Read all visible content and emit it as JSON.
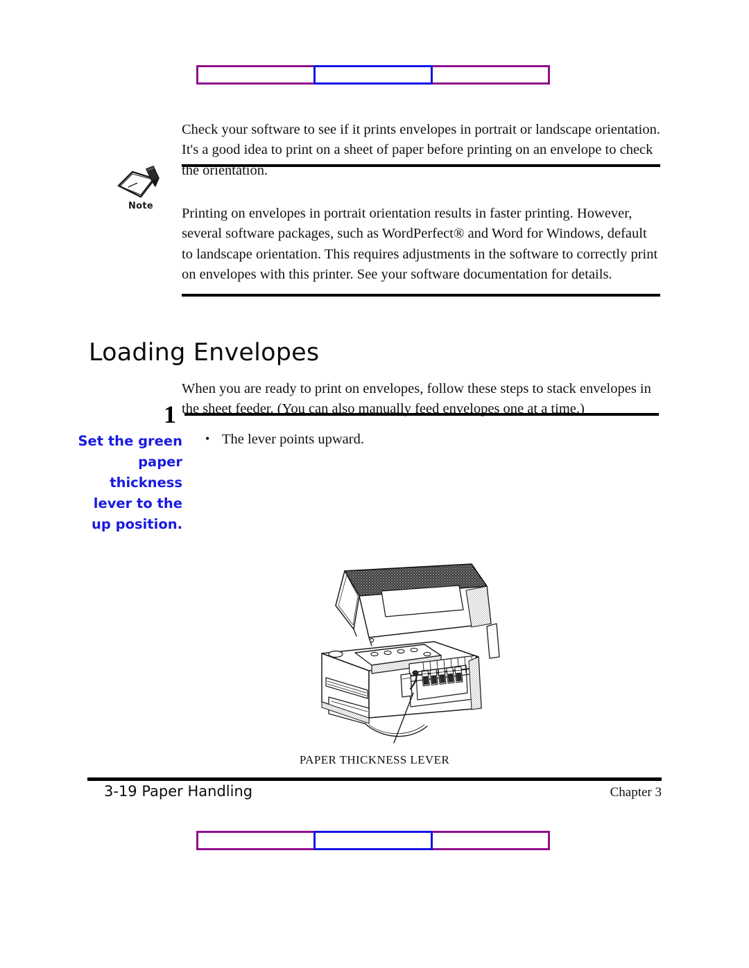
{
  "document": {
    "type": "printer-user-manual-page",
    "page_label": "3-19",
    "chapter_label": "Chapter 3"
  },
  "decoration": {
    "segments": [
      {
        "name": "left-segment",
        "color": "#8e0f8e"
      },
      {
        "name": "center-segment",
        "color": "#1414e6"
      },
      {
        "name": "right-segment",
        "color": "#8e0f8e"
      }
    ]
  },
  "intro": {
    "paragraph": "Check your software to see if it prints envelopes in portrait or landscape orientation. It's a good idea to print on a sheet of paper before printing on an envelope to check the orientation."
  },
  "note": {
    "icon_label": "Note",
    "icon_name": "note-pencil-icon",
    "paragraph": "Printing on envelopes in portrait orientation results in faster printing. However, several software packages, such as WordPerfect® and Word for Windows, default to landscape orientation. This requires adjustments in the software to correctly print on envelopes with this printer. See your software documentation for details."
  },
  "section": {
    "heading": "Loading Envelopes",
    "intro": "When you are ready to print on envelopes, follow these steps to stack envelopes in the sheet feeder. (You can also manually feed envelopes one at a time.)"
  },
  "step": {
    "number": "1",
    "instruction": "Set the green paper thickness lever to the up position.",
    "bullets": [
      "The lever points upward."
    ]
  },
  "figure": {
    "name": "printer-illustration",
    "caption": "PAPER THICKNESS LEVER",
    "description": "Line drawing of an inkjet printer with the top cover opened showing the print head carriage and ink cartridges, with a leader line pointing to the paper thickness lever."
  },
  "footer": {
    "left": "3-19 Paper Handling",
    "right": "Chapter 3"
  },
  "colors": {
    "accent_blue": "#1a1ae0",
    "accent_purple": "#8e0f8e",
    "text": "#111111"
  }
}
